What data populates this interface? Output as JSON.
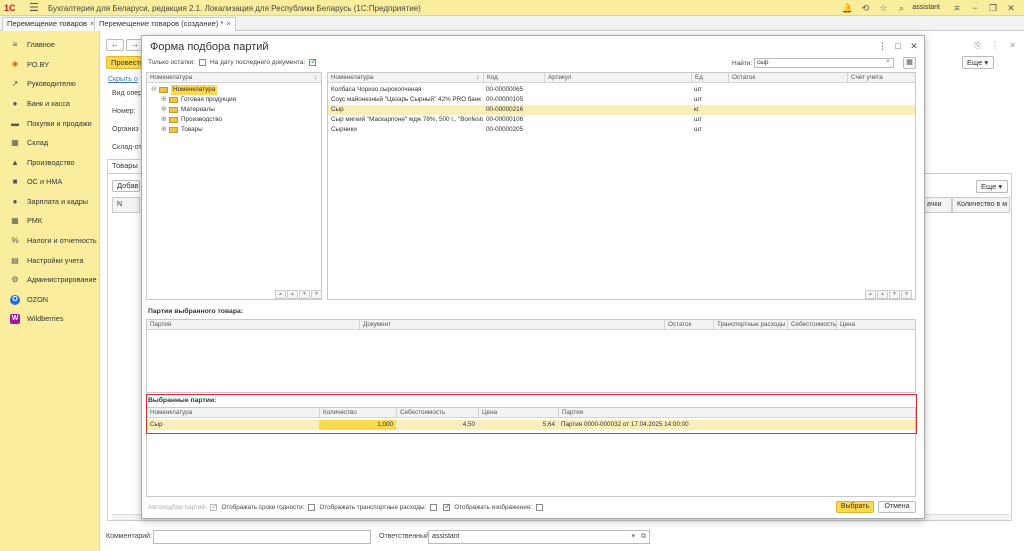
{
  "app": {
    "logo": "1С",
    "title": "Бухгалтерия для Беларуси, редакция 2.1. Локализация для Республики Беларусь  (1С:Предприятие)",
    "user": "assistant"
  },
  "tabs": [
    {
      "label": "Перемещение товаров",
      "close": "×"
    },
    {
      "label": "Перемещение товаров (создание) *",
      "close": "×"
    }
  ],
  "sidebar": {
    "items": [
      {
        "label": "Главное",
        "icon": "≡"
      },
      {
        "label": "PO.BY",
        "icon": "✱"
      },
      {
        "label": "Руководителю",
        "icon": "↗"
      },
      {
        "label": "Банк и касса",
        "icon": "●"
      },
      {
        "label": "Покупки и продажи",
        "icon": "▬"
      },
      {
        "label": "Склад",
        "icon": "▦"
      },
      {
        "label": "Производство",
        "icon": "▲"
      },
      {
        "label": "ОС и НМА",
        "icon": "■"
      },
      {
        "label": "Зарплата и кадры",
        "icon": "●"
      },
      {
        "label": "РМК",
        "icon": "▦"
      },
      {
        "label": "Налоги и отчетность",
        "icon": "%"
      },
      {
        "label": "Настройки учета",
        "icon": "▤"
      },
      {
        "label": "Администрирование",
        "icon": "⚙"
      },
      {
        "label": "OZON",
        "icon": "O"
      },
      {
        "label": "Wildberries",
        "icon": "W"
      }
    ]
  },
  "background_form": {
    "post_button": "Провести",
    "hide_link": "Скрыть о",
    "labels": [
      "Вид опер",
      "Номер:",
      "Организ",
      "Склад-от"
    ],
    "more": "Еще",
    "tab_goods": "Товары",
    "add_button": "Добав",
    "col_n": "N",
    "col_tail": "ачки",
    "col_qty": "Количество в м",
    "comment_label": "Комментарий:",
    "responsible_label": "Ответственный:",
    "responsible_value": "assistant"
  },
  "dialog": {
    "title": "Форма подбора партий",
    "only_rests_label": "Только остатки:",
    "only_rests_checked": false,
    "last_doc_label": "На дату последнего документа:",
    "last_doc_checked": true,
    "find_label": "Найти:",
    "find_value": "сыр",
    "find_clear": "×",
    "tree": {
      "header": "Номенклатура",
      "root": "Номенклатура",
      "children": [
        "Готовая продукция",
        "Материалы",
        "Производство",
        "Товары"
      ]
    },
    "items": {
      "headers": [
        "Номенклатура",
        "Код",
        "Артикул",
        "Ед",
        "Остаток",
        "Счет учета"
      ],
      "rows": [
        {
          "name": "Колбаса Чоризо сырокопченая",
          "code": "00-00000065",
          "sku": "",
          "unit": "шт"
        },
        {
          "name": "Соус майонезный \"Цезарь Сырный\" 42% PRO банк 1...",
          "code": "00-00000105",
          "sku": "",
          "unit": "шт"
        },
        {
          "name": "Сыр",
          "code": "00-00000216",
          "sku": "",
          "unit": "кг"
        },
        {
          "name": "Сыр мягкий \"Маскарпоне\" мдж 78%, 500 г., \"Bonfesto...",
          "code": "00-00000106",
          "sku": "",
          "unit": "шт"
        },
        {
          "name": "Сырники",
          "code": "00-00000205",
          "sku": "",
          "unit": "шт"
        }
      ]
    },
    "batches": {
      "title": "Партии выбранного товара:",
      "headers": [
        "Партия",
        "Документ",
        "Остаток",
        "Транспортные расходы",
        "Себестоимость",
        "Цена"
      ]
    },
    "selected": {
      "title": "Выбранные партии:",
      "headers": [
        "Номенклатура",
        "Количество",
        "Себестоимость",
        "Цена",
        "Партия"
      ],
      "rows": [
        {
          "name": "Сыр",
          "qty": "1,000",
          "cost": "4,50",
          "price": "5,64",
          "batch": "Партия 0000-000032 от 17.04.2025 14:00:00"
        }
      ]
    },
    "bottom": {
      "auto_label": "Автоподбор партий:",
      "auto_checked": true,
      "expiry_label": "Отображать сроки годности:",
      "expiry_checked": false,
      "transport_label": "Отображать транспортные расходы:",
      "transport_checked": false,
      "images_label": "Отображать изображения:",
      "images_checked": true,
      "tail_checked": false
    },
    "select_button": "Выбрать",
    "cancel_button": "Отмена"
  }
}
